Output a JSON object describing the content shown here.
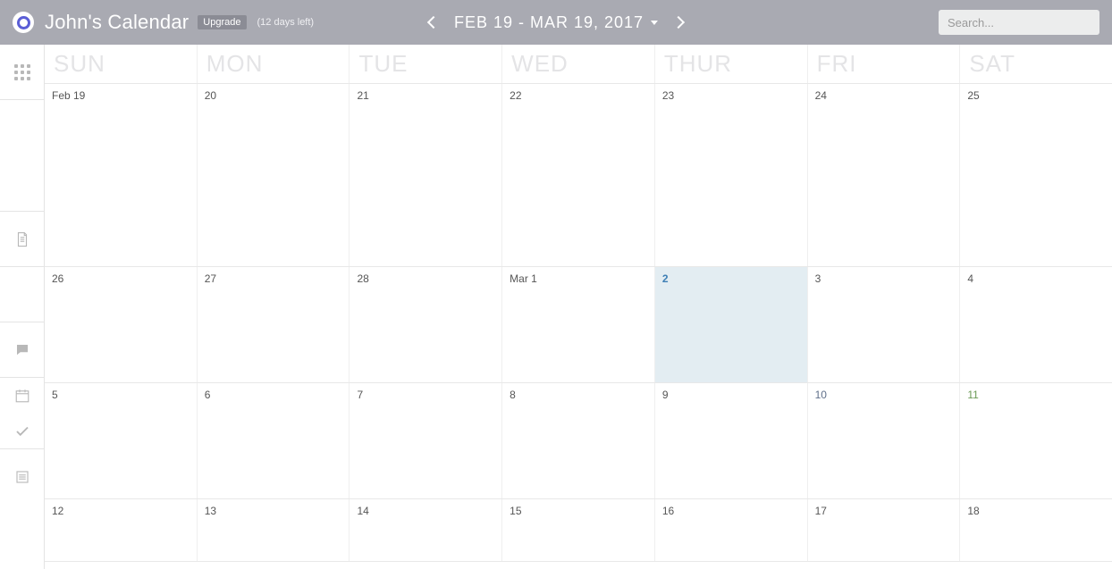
{
  "header": {
    "title": "John's Calendar",
    "upgrade_label": "Upgrade",
    "days_left": "(12 days left)",
    "date_range": "FEB 19 - MAR 19, 2017",
    "search_placeholder": "Search..."
  },
  "day_headers": [
    "SUN",
    "MON",
    "TUE",
    "WED",
    "THUR",
    "FRI",
    "SAT"
  ],
  "weeks": [
    {
      "h": "h-large",
      "cells": [
        {
          "label": "Feb 19"
        },
        {
          "label": "20"
        },
        {
          "label": "21"
        },
        {
          "label": "22"
        },
        {
          "label": "23"
        },
        {
          "label": "24"
        },
        {
          "label": "25"
        }
      ]
    },
    {
      "h": "h-mid",
      "cells": [
        {
          "label": "26"
        },
        {
          "label": "27"
        },
        {
          "label": "28"
        },
        {
          "label": "Mar 1"
        },
        {
          "label": "2",
          "today": true
        },
        {
          "label": "3"
        },
        {
          "label": "4"
        }
      ]
    },
    {
      "h": "h-mid",
      "cells": [
        {
          "label": "5"
        },
        {
          "label": "6"
        },
        {
          "label": "7"
        },
        {
          "label": "8"
        },
        {
          "label": "9"
        },
        {
          "label": "10",
          "cls": "muted"
        },
        {
          "label": "11",
          "cls": "green"
        }
      ]
    },
    {
      "h": "h-last",
      "cells": [
        {
          "label": "12"
        },
        {
          "label": "13"
        },
        {
          "label": "14"
        },
        {
          "label": "15"
        },
        {
          "label": "16"
        },
        {
          "label": "17"
        },
        {
          "label": "18"
        }
      ]
    }
  ]
}
